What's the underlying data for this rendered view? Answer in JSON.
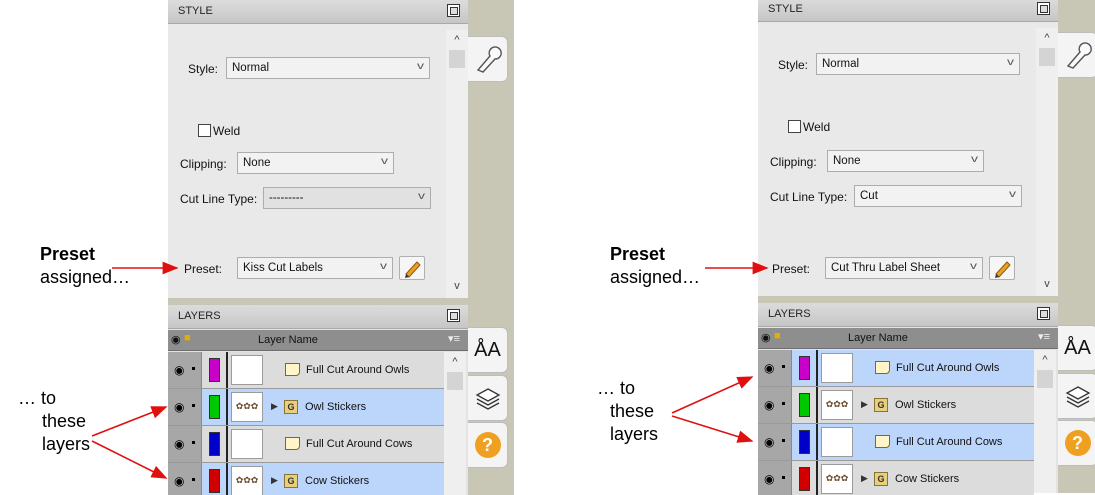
{
  "annotations": {
    "preset_word": "Preset",
    "assigned_text": "assigned…",
    "to_text": "… to",
    "these_text": "these",
    "layers_text": "layers"
  },
  "panels": [
    {
      "style_header": "STYLE",
      "style_label": "Style:",
      "style_value": "Normal",
      "weld_label": "Weld",
      "clipping_label": "Clipping:",
      "clipping_value": "None",
      "cut_line_type_label": "Cut Line Type:",
      "cut_line_type_value": "---------",
      "preset_label": "Preset:",
      "preset_value": "Kiss Cut Labels",
      "layers_header": "LAYERS",
      "layer_name_header": "Layer Name",
      "layers": [
        {
          "name": "Full Cut Around Owls",
          "color": "#c800c8",
          "kind": "shape",
          "selected": false
        },
        {
          "name": "Owl Stickers",
          "color": "#00c800",
          "kind": "group",
          "selected": true
        },
        {
          "name": "Full Cut Around Cows",
          "color": "#0000c8",
          "kind": "shape",
          "selected": false
        },
        {
          "name": "Cow Stickers",
          "color": "#d00000",
          "kind": "group",
          "selected": true
        }
      ]
    },
    {
      "style_header": "STYLE",
      "style_label": "Style:",
      "style_value": "Normal",
      "weld_label": "Weld",
      "clipping_label": "Clipping:",
      "clipping_value": "None",
      "cut_line_type_label": "Cut Line Type:",
      "cut_line_type_value": "Cut",
      "preset_label": "Preset:",
      "preset_value": "Cut Thru Label Sheet",
      "layers_header": "LAYERS",
      "layer_name_header": "Layer Name",
      "layers": [
        {
          "name": "Full Cut Around Owls",
          "color": "#c800c8",
          "kind": "shape",
          "selected": true
        },
        {
          "name": "Owl Stickers",
          "color": "#00c800",
          "kind": "group",
          "selected": false
        },
        {
          "name": "Full Cut Around Cows",
          "color": "#0000c8",
          "kind": "shape",
          "selected": true
        },
        {
          "name": "Cow Stickers",
          "color": "#d00000",
          "kind": "group",
          "selected": false
        }
      ]
    }
  ],
  "sidebar_icons": [
    "wrench-icon",
    "text-size-icon",
    "layers-icon",
    "help-icon"
  ],
  "colors": {
    "arrow": "#e01010",
    "selected_row": "#bcd6fb",
    "panel_bg": "#c8c6b4"
  }
}
